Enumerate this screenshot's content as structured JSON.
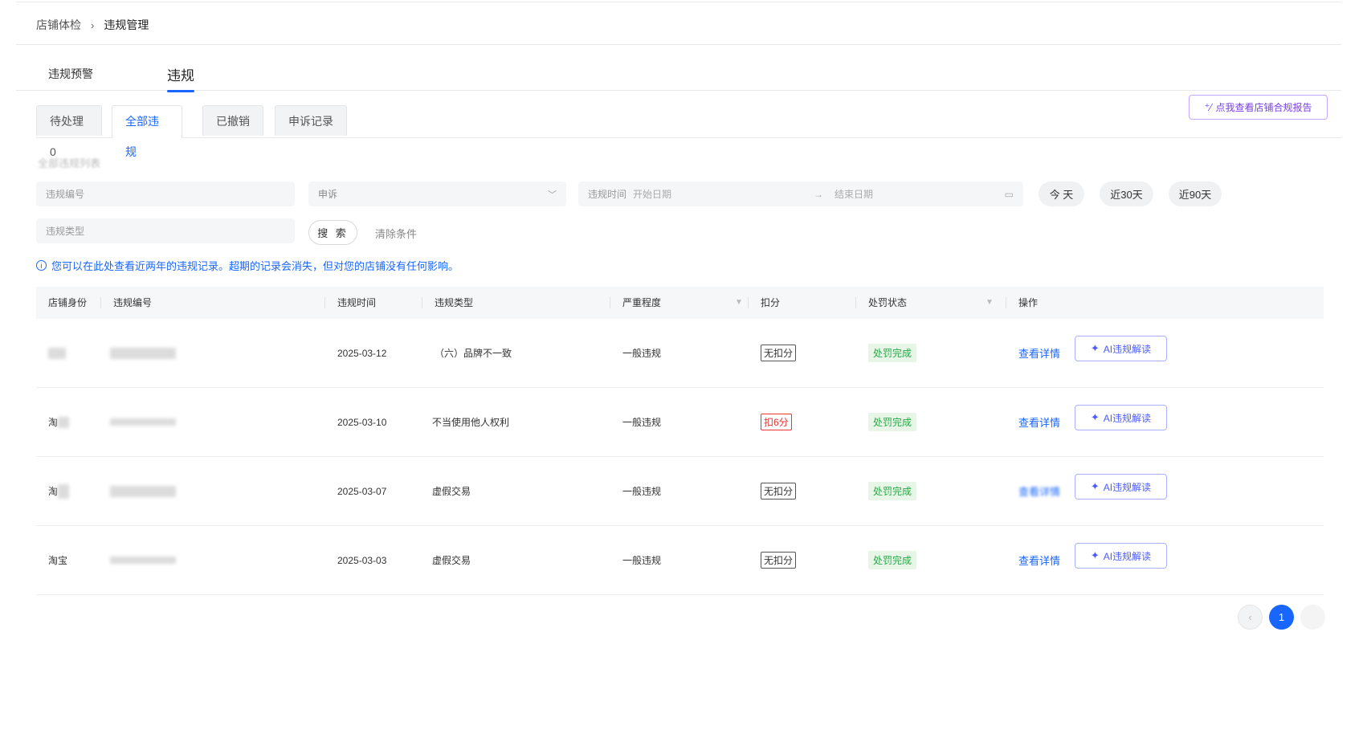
{
  "breadcrumb": {
    "parent": "店铺体检",
    "separator": "›",
    "current": "违规管理"
  },
  "main_tabs": [
    {
      "label": "违规预警"
    },
    {
      "label": "违规",
      "active": true
    }
  ],
  "sub_tabs": [
    {
      "label": "待处理 0"
    },
    {
      "label": "全部违规",
      "active": true
    },
    {
      "label": "已撤销"
    },
    {
      "label": "申诉记录"
    }
  ],
  "report_button": {
    "label": "点我查看店铺合规报告",
    "icon": "sparkle-icon"
  },
  "list_title": "全部违规列表",
  "filters": {
    "violation_no": {
      "placeholder": "违规编号"
    },
    "appeal": {
      "value": "申诉",
      "icon": "chevron-down-icon"
    },
    "time_range": {
      "label": "违规时间",
      "start_placeholder": "开始日期",
      "end_placeholder": "结束日期",
      "icon": "calendar-icon"
    },
    "quick_ranges": [
      "今 天",
      "近30天",
      "近90天"
    ],
    "violation_type": {
      "placeholder": "违规类型"
    },
    "search_label": "搜 索",
    "clear_label": "清除条件"
  },
  "notice": {
    "icon": "info-icon",
    "text": "您可以在此处查看近两年的违规记录。超期的记录会消失，但对您的店铺没有任何影响。"
  },
  "table": {
    "columns": [
      "店铺身份",
      "违规编号",
      "违规时间",
      "违规类型",
      "严重程度",
      "扣分",
      "处罚状态",
      "操作"
    ],
    "rows": [
      {
        "shop": "",
        "number": "",
        "time": "2025-03-12",
        "type": "（六）品牌不一致",
        "severity": "一般违规",
        "deduction": "无扣分",
        "deduction_style": "gray",
        "status": "处罚完成",
        "detail": "查看详情",
        "ai": "AI违规解读"
      },
      {
        "shop": "淘",
        "number": "",
        "time": "2025-03-10",
        "type": "不当使用他人权利",
        "severity": "一般违规",
        "deduction": "扣6分",
        "deduction_style": "red",
        "status": "处罚完成",
        "detail": "查看详情",
        "ai": "AI违规解读"
      },
      {
        "shop": "淘",
        "number": "",
        "time": "2025-03-07",
        "type": "虚假交易",
        "severity": "一般违规",
        "deduction": "无扣分",
        "deduction_style": "gray",
        "status": "处罚完成",
        "detail": "查看详情",
        "ai": "AI违规解读"
      },
      {
        "shop": "淘宝",
        "number": "",
        "time": "2025-03-03",
        "type": "虚假交易",
        "severity": "一般违规",
        "deduction": "无扣分",
        "deduction_style": "gray",
        "status": "处罚完成",
        "detail": "查看详情",
        "ai": "AI违规解读"
      }
    ]
  },
  "pagination": {
    "current_page": "1",
    "prev_icon": "chevron-left-icon"
  },
  "colors": {
    "primary": "#1966ff",
    "danger": "#ee3333",
    "success": "#2aa84a",
    "ai_accent": "#4d5cff"
  }
}
